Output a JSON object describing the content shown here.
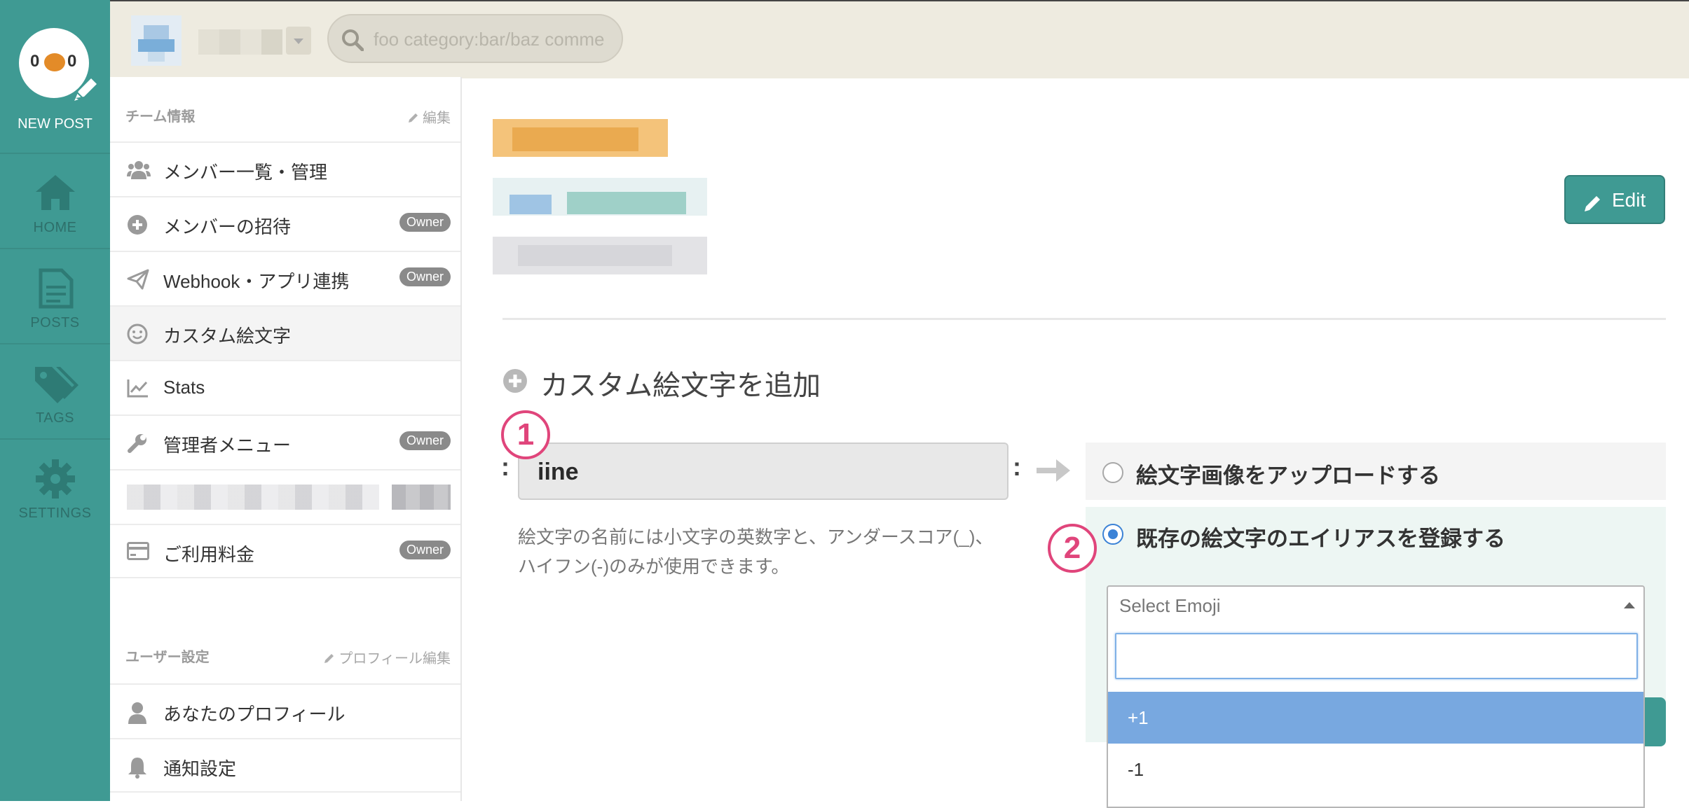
{
  "rail": {
    "logo_left": "0",
    "logo_right": "0",
    "new_post": "NEW POST",
    "items": [
      {
        "label": "HOME"
      },
      {
        "label": "POSTS"
      },
      {
        "label": "TAGS"
      },
      {
        "label": "SETTINGS"
      }
    ]
  },
  "topbar": {
    "search_placeholder": "foo category:bar/baz comment:foobar"
  },
  "sidebar": {
    "team_heading": "チーム情報",
    "team_edit": "編集",
    "team_items": [
      {
        "label": "メンバー一覧・管理",
        "badge": ""
      },
      {
        "label": "メンバーの招待",
        "badge": "Owner"
      },
      {
        "label": "Webhook・アプリ連携",
        "badge": "Owner"
      },
      {
        "label": "カスタム絵文字",
        "badge": ""
      },
      {
        "label": "Stats",
        "badge": ""
      },
      {
        "label": "管理者メニュー",
        "badge": "Owner"
      },
      {
        "label": "",
        "badge": ""
      },
      {
        "label": "ご利用料金",
        "badge": "Owner"
      }
    ],
    "user_heading": "ユーザー設定",
    "user_edit": "プロフィール編集",
    "user_items": [
      {
        "label": "あなたのプロフィール"
      },
      {
        "label": "通知設定"
      }
    ]
  },
  "main": {
    "edit_label": "Edit",
    "add_heading": "カスタム絵文字を追加",
    "colon_left": ":",
    "colon_right": ":",
    "emoji_name_value": "iine",
    "step1": "1",
    "step2": "2",
    "helper_text": "絵文字の名前には小文字の英数字と、アンダースコア(_)、ハイフン(-)のみが使用できます。",
    "option_upload": "絵文字画像をアップロードする",
    "option_alias": "既存の絵文字のエイリアスを登録する",
    "select_placeholder": "Select Emoji",
    "dropdown_options": [
      "+1",
      "-1"
    ]
  },
  "colors": {
    "accent": "#3f9a93",
    "step_marker": "#e0457b",
    "radio_selected": "#3b82d6",
    "highlight": "#78a8e0"
  }
}
